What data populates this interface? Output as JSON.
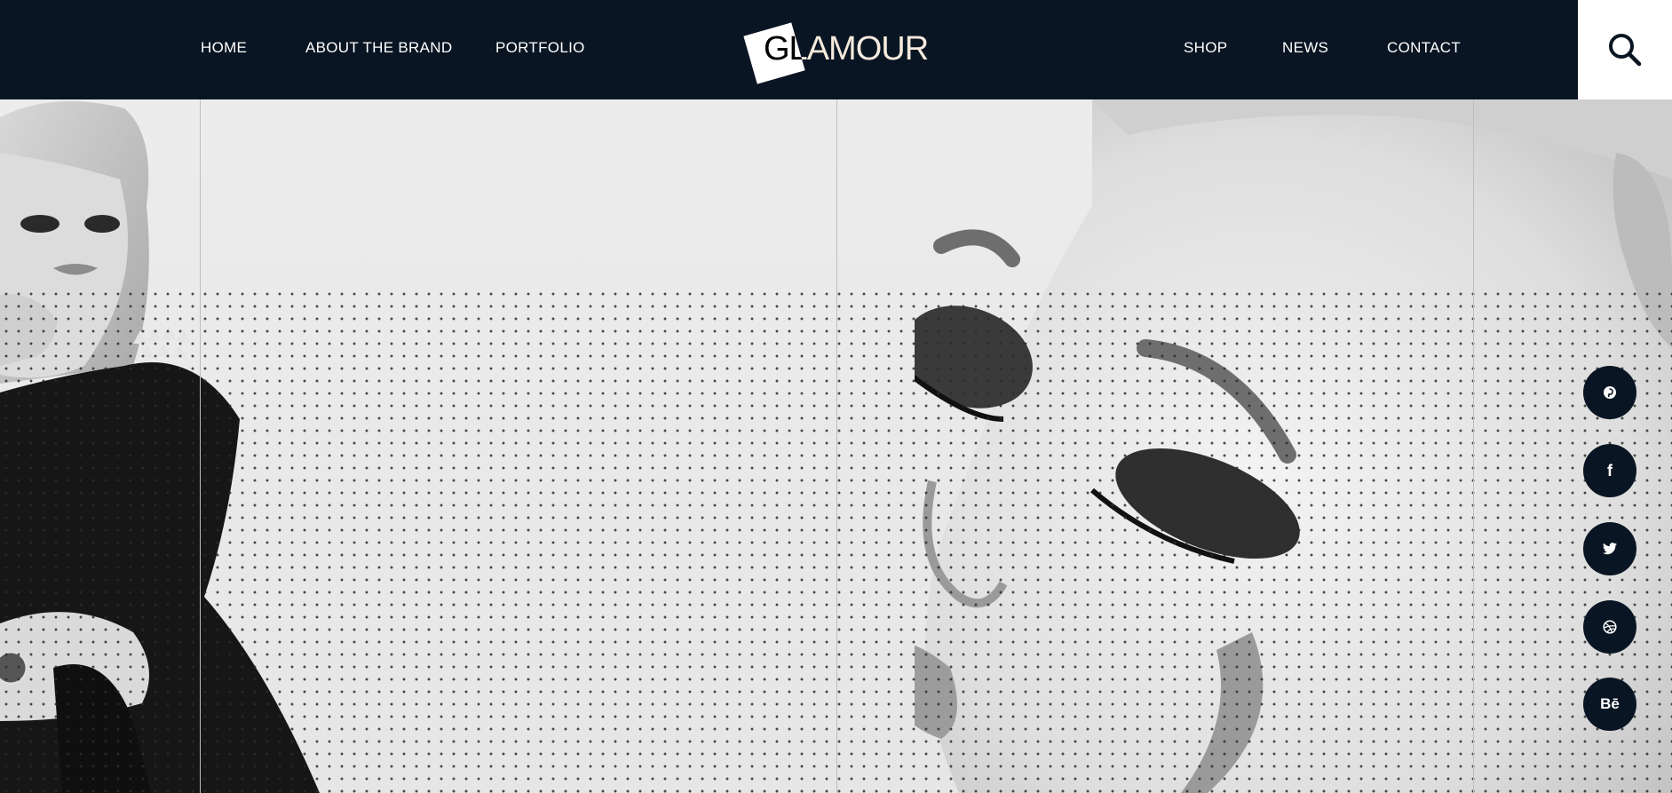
{
  "nav": {
    "left": [
      "HOME",
      "ABOUT THE BRAND",
      "PORTFOLIO"
    ],
    "right": [
      "SHOP",
      "NEWS",
      "CONTACT"
    ]
  },
  "logo": {
    "text": "GLAMOUR"
  },
  "search": {
    "icon": "search-icon"
  },
  "social": [
    {
      "name": "pinterest",
      "glyph": "℗"
    },
    {
      "name": "facebook",
      "glyph": "f"
    },
    {
      "name": "twitter",
      "glyph": "🐦"
    },
    {
      "name": "dribbble",
      "glyph": "⊛"
    },
    {
      "name": "behance",
      "glyph": "Bē"
    }
  ],
  "colors": {
    "header_bg": "#0a1523",
    "accent": "#ffffff",
    "hero_bg": "#e9e9e9"
  }
}
